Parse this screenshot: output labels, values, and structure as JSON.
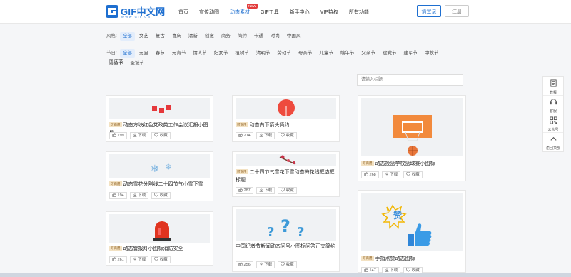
{
  "header": {
    "logo_text": "GIF中文网",
    "logo_sub": "WWW.GIF.CN",
    "nav": [
      {
        "label": "首页",
        "new": false
      },
      {
        "label": "宣传动图",
        "new": false
      },
      {
        "label": "动态素材",
        "new": true
      },
      {
        "label": "GIF工具",
        "new": false
      },
      {
        "label": "新手中心",
        "new": false
      },
      {
        "label": "VIP特权",
        "new": false
      },
      {
        "label": "所有功能",
        "new": false
      }
    ],
    "new_badge": "NEW",
    "login_label": "请登录",
    "register_label": "注册"
  },
  "filters": {
    "style_label": "风格:",
    "styles": [
      "全部",
      "文艺",
      "复古",
      "喜庆",
      "清新",
      "创意",
      "商务",
      "简约",
      "卡通",
      "时尚",
      "中国风"
    ],
    "fest_label": "节日:",
    "festivals": [
      "全部",
      "元旦",
      "春节",
      "元宵节",
      "情人节",
      "妇女节",
      "植树节",
      "清明节",
      "劳动节",
      "母亲节",
      "儿童节",
      "端午节",
      "父亲节",
      "建党节",
      "建军节",
      "中秋节",
      "国庆节"
    ],
    "festivals_row2": [
      "万圣节",
      "圣诞节"
    ]
  },
  "search": {
    "placeholder": "请输入标题"
  },
  "cards": [
    {
      "badge": "可商用",
      "title": "动态方块红色党政类工作会议汇报小图标",
      "likes": "199",
      "download": "下载",
      "collect": "收藏"
    },
    {
      "badge": "可商用",
      "title": "动态向下箭头简约",
      "likes": "214",
      "download": "下载",
      "collect": "收藏"
    },
    {
      "badge": "可商用",
      "title": "动态投篮学校篮球赛小图标",
      "likes": "268",
      "download": "下载",
      "collect": "收藏"
    },
    {
      "badge": "可商用",
      "title": "动态雪花分割线二十四节气小雪下雪",
      "likes": "194",
      "download": "下载",
      "collect": "收藏"
    },
    {
      "badge": "可商用",
      "title": "二十四节气雪花下雪动态梅花线框边框标题",
      "likes": "287",
      "download": "下载",
      "collect": "收藏"
    },
    {
      "badge": "可商用",
      "title": "动态警报灯小图标消防安全",
      "likes": "261",
      "download": "下载",
      "collect": "收藏"
    },
    {
      "badge": "",
      "title": "中国记者节新闻动态问号小图标问答正文简约",
      "likes": "256",
      "download": "下载",
      "collect": "收藏"
    },
    {
      "badge": "可商用",
      "title": "手指点赞动态图标",
      "likes": "147",
      "download": "下载",
      "collect": "收藏"
    }
  ],
  "side": [
    {
      "label": "教程",
      "icon": "book-icon"
    },
    {
      "label": "客服",
      "icon": "headset-icon"
    },
    {
      "label": "公众号",
      "icon": "qrcode-icon"
    },
    {
      "label": "返回顶部",
      "icon": "arrow-up-icon"
    }
  ],
  "colors": {
    "brand": "#1e6fd0",
    "badge_bg": "#f3e2c3",
    "new_badge": "#e23c3c"
  }
}
